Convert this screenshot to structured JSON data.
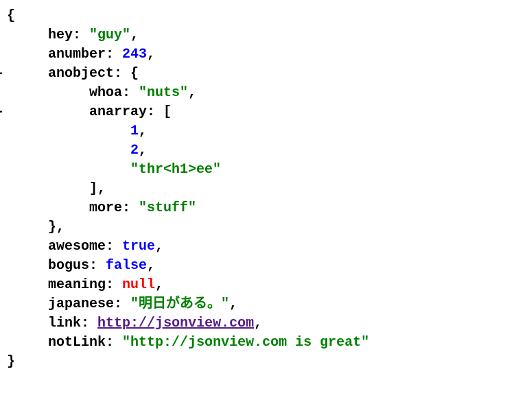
{
  "json": {
    "open_brace": "{",
    "close_brace": "}",
    "open_bracket": "[",
    "close_bracket": "]",
    "colon": ":",
    "comma": ",",
    "collapse_marker": "-",
    "keys": {
      "hey": "hey",
      "anumber": "anumber",
      "anobject": "anobject",
      "whoa": "whoa",
      "anarray": "anarray",
      "more": "more",
      "awesome": "awesome",
      "bogus": "bogus",
      "meaning": "meaning",
      "japanese": "japanese",
      "link": "link",
      "notLink": "notLink"
    },
    "values": {
      "hey": "\"guy\"",
      "anumber": "243",
      "whoa": "\"nuts\"",
      "arr0": "1",
      "arr1": "2",
      "arr2": "\"thr<h1>ee\"",
      "more": "\"stuff\"",
      "awesome": "true",
      "bogus": "false",
      "meaning": "null",
      "japanese": "\"明日がある。\"",
      "link": "http://jsonview.com",
      "notLink": "\"http://jsonview.com is great\""
    }
  }
}
